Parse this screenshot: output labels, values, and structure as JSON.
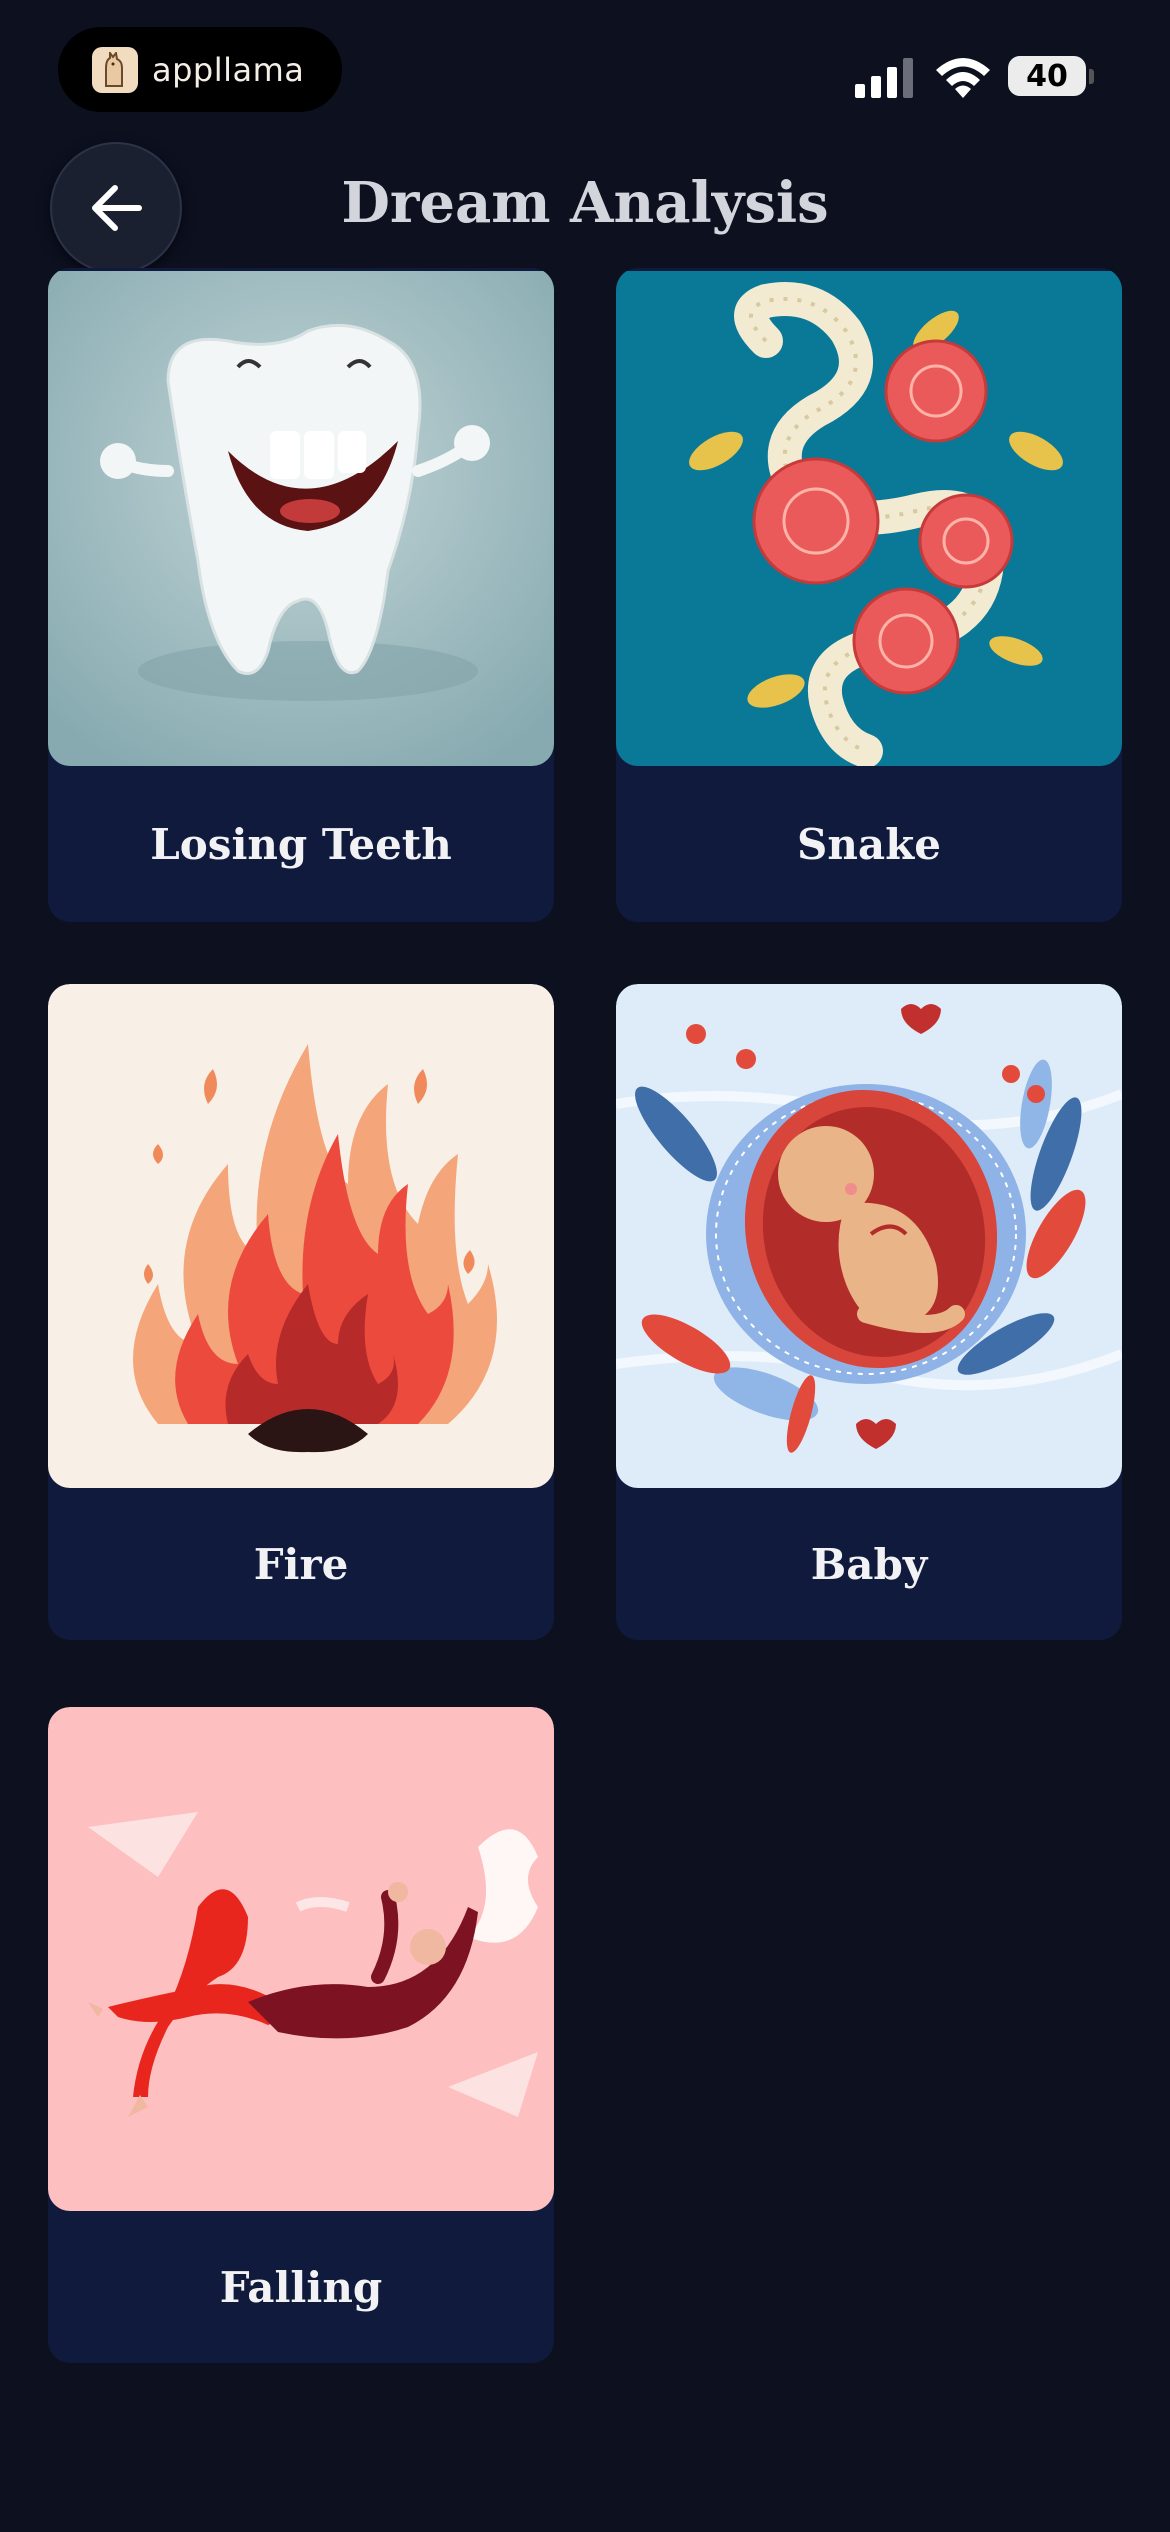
{
  "status_bar": {
    "brand": "appllama",
    "battery": "40"
  },
  "header": {
    "title": "Dream Analysis"
  },
  "cards": [
    {
      "label": "Losing Teeth"
    },
    {
      "label": "Snake"
    },
    {
      "label": "Fire"
    },
    {
      "label": "Baby"
    },
    {
      "label": "Falling"
    }
  ],
  "colors": {
    "background": "#0c101f",
    "card": "#0f1a3d",
    "title": "#d3d5dd"
  }
}
